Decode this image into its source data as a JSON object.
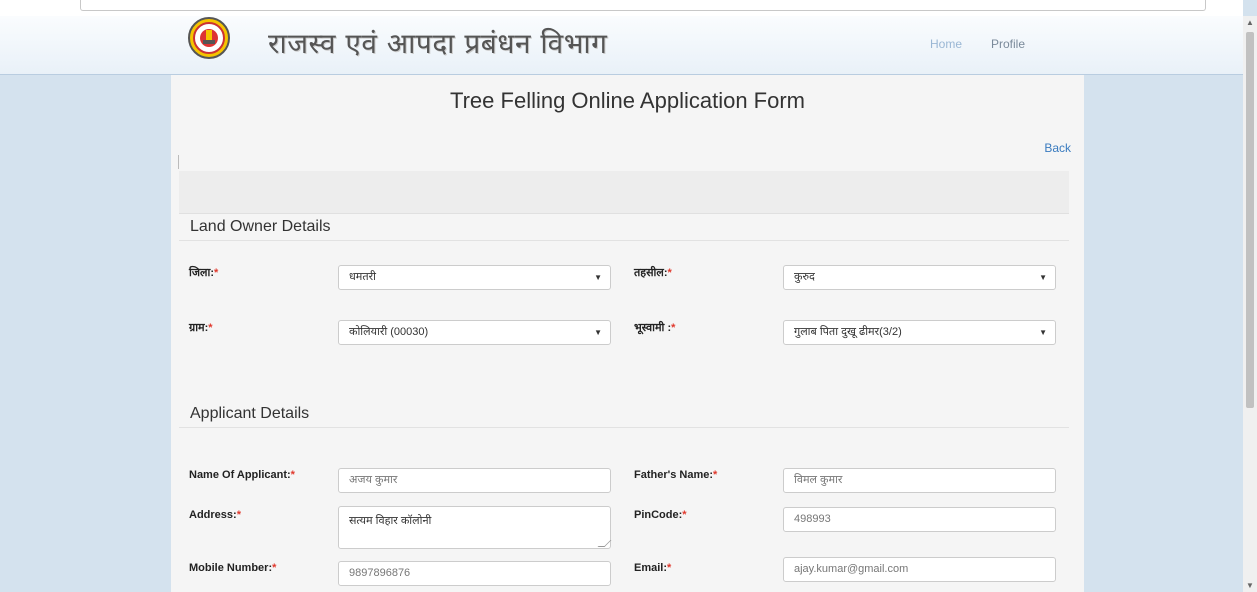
{
  "header": {
    "brand": "राजस्व एवं आपदा प्रबंधन विभाग",
    "nav": {
      "home": "Home",
      "profile": "Profile"
    }
  },
  "page": {
    "title": "Tree Felling Online Application Form",
    "back": "Back"
  },
  "land_owner": {
    "heading": "Land Owner Details",
    "jila_label": "जिला:",
    "jila_value": "धमतरी",
    "tahsil_label": "तहसील:",
    "tahsil_value": "कुरुद",
    "gram_label": "ग्राम:",
    "gram_value": "कोलियारी (00030)",
    "bhuswami_label": "भूस्वामी :",
    "bhuswami_value": "गुलाब पिता दुखू ढीमर(3/2)"
  },
  "applicant": {
    "heading": "Applicant  Details",
    "name_label": "Name Of Applicant:",
    "name_value": "अजय कुमार",
    "father_label": "Father's Name:",
    "father_value": "विमल कुमार",
    "address_label": "Address:",
    "address_value": "सत्यम विहार कॉलोनी",
    "pincode_label": "PinCode:",
    "pincode_value": "498993",
    "mobile_label": "Mobile Number:",
    "mobile_value": "9897896876",
    "email_label": "Email:",
    "email_value": "ajay.kumar@gmail.com"
  },
  "required_marker": "*",
  "colors": {
    "accent": "#3a7bbf",
    "required": "#e0382c",
    "background": "#d4e2ee"
  }
}
